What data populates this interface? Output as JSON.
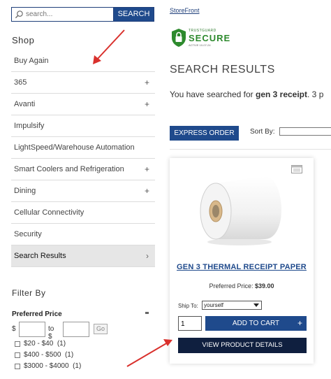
{
  "search": {
    "placeholder": "search...",
    "button_label": "SEARCH"
  },
  "sidebar": {
    "shop_title": "Shop",
    "items": [
      {
        "label": "Buy Again",
        "expandable": false
      },
      {
        "label": "365",
        "expandable": true
      },
      {
        "label": "Avanti",
        "expandable": true
      },
      {
        "label": "Impulsify",
        "expandable": false
      },
      {
        "label": "LightSpeed/Warehouse Automation",
        "expandable": false
      },
      {
        "label": "Smart Coolers and Refrigeration",
        "expandable": true
      },
      {
        "label": "Dining",
        "expandable": true
      },
      {
        "label": "Cellular Connectivity",
        "expandable": false
      },
      {
        "label": "Security",
        "expandable": false
      },
      {
        "label": "Search Results",
        "expandable": false,
        "active": true
      }
    ],
    "plus_glyph": "+",
    "chevron_glyph": "›"
  },
  "filter": {
    "title": "Filter By",
    "price_heading": "Preferred Price",
    "currency_symbol": "$",
    "to_label": "to $",
    "go_label": "Go",
    "options": [
      {
        "label": "$20 - $40",
        "count": "(1)"
      },
      {
        "label": "$400 - $500",
        "count": "(1)"
      },
      {
        "label": "$3000 - $4000",
        "count": "(1)"
      }
    ]
  },
  "breadcrumb": "StoreFront",
  "trust_badge": {
    "top": "TRUSTGUARD",
    "main": "SECURE",
    "bottom": "ACTIVE 10-07-24",
    "color": "#2d8a2d"
  },
  "main": {
    "title": "SEARCH RESULTS",
    "searched_prefix": "You have searched for ",
    "searched_term": "gen 3 receipt",
    "searched_suffix": ". 3 p",
    "express_order_label": "EXPRESS ORDER",
    "sort_by_label": "Sort By:"
  },
  "product": {
    "name": "GEN 3 THERMAL RECEIPT PAPER",
    "price_label": "Preferred Price:",
    "price_value": "$39.00",
    "ship_to_label": "Ship To:",
    "ship_to_value": "yourself",
    "quantity": "1",
    "add_to_cart_label": "ADD TO CART",
    "add_glyph": "+",
    "view_details_label": "VIEW PRODUCT DETAILS"
  },
  "colors": {
    "primary": "#1f4a8c",
    "dark": "#0f1f3f",
    "annotation_arrow": "#d9302c"
  },
  "icons": [
    "search-icon",
    "plus-icon",
    "chevron-right-icon",
    "list-view-icon",
    "shield-lock-icon"
  ]
}
